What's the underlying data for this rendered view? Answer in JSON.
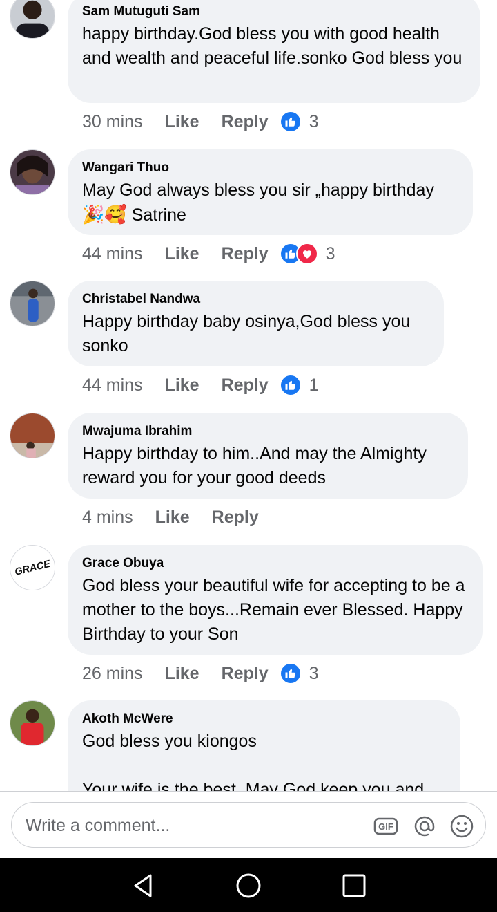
{
  "comments": [
    {
      "author": "Sam Mutuguti Sam",
      "text": "happy birthday.God bless you with good health and wealth and peaceful life.sonko God bless you",
      "time": "30 mins",
      "like_label": "Like",
      "reply_label": "Reply",
      "reaction_count": "3",
      "reactions": [
        "like-icon"
      ]
    },
    {
      "author": "Wangari Thuo",
      "text": "May God always bless you sir „happy birthday",
      "text_emoji": "🎉🥰",
      "text_tail": " Satrine",
      "time": "44 mins",
      "like_label": "Like",
      "reply_label": "Reply",
      "reaction_count": "3",
      "reactions": [
        "like-icon",
        "love-icon"
      ]
    },
    {
      "author": "Christabel Nandwa",
      "text": "Happy birthday baby osinya,God bless you sonko",
      "time": "44 mins",
      "like_label": "Like",
      "reply_label": "Reply",
      "reaction_count": "1",
      "reactions": [
        "like-icon"
      ]
    },
    {
      "author": "Mwajuma Ibrahim",
      "text": "Happy birthday to him..And may the Almighty reward you for your good deeds",
      "time": "4 mins",
      "like_label": "Like",
      "reply_label": "Reply",
      "reaction_count": "",
      "reactions": []
    },
    {
      "author": "Grace Obuya",
      "avatar_text": "GRACE",
      "text": "God bless your beautiful wife for accepting to be a mother to the boys...Remain ever Blessed. Happy Birthday to your Son",
      "time": "26 mins",
      "like_label": "Like",
      "reply_label": "Reply",
      "reaction_count": "3",
      "reactions": [
        "like-icon"
      ]
    },
    {
      "author": "Akoth McWere",
      "text": "God bless you kiongos\n\nYour wife is the best. May God keep you and"
    }
  ],
  "composer": {
    "placeholder": "Write a comment...",
    "icons": [
      "gif-icon",
      "mention-icon",
      "emoji-icon"
    ]
  },
  "navbar": {
    "icons": [
      "back-icon",
      "home-icon",
      "recents-icon"
    ]
  },
  "colors": {
    "bubble": "#f0f2f5",
    "like_blue": "#1877f2",
    "love_red": "#f02849",
    "meta_gray": "#65676b"
  }
}
